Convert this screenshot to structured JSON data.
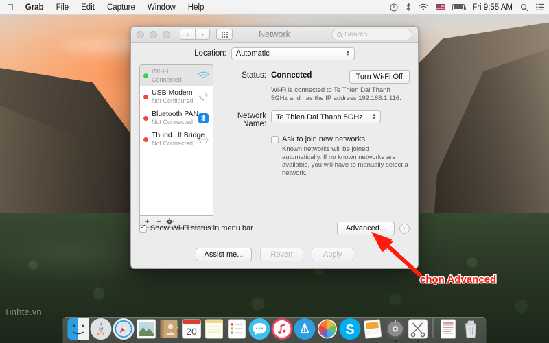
{
  "menubar": {
    "apple_icon": "apple-logo",
    "items": [
      {
        "label": "Grab",
        "bold": true
      },
      {
        "label": "File",
        "bold": false
      },
      {
        "label": "Edit",
        "bold": false
      },
      {
        "label": "Capture",
        "bold": false
      },
      {
        "label": "Window",
        "bold": false
      },
      {
        "label": "Help",
        "bold": false
      }
    ],
    "status_icons": [
      "power-icon",
      "bluetooth-icon",
      "wifi-icon",
      "us-flag-icon",
      "battery-icon"
    ],
    "clock": "Fri 9:55 AM",
    "search_icon": "spotlight-search-icon",
    "notification_icon": "notification-center-icon"
  },
  "window": {
    "title": "Network",
    "search_placeholder": "Search",
    "nav_back": "‹",
    "nav_forward": "›",
    "grid_icon": "show-all-grid-icon",
    "location_label": "Location:",
    "location_value": "Automatic"
  },
  "services": [
    {
      "name": "Wi-Fi",
      "state": "Connected",
      "dot": "green",
      "icon": "wifi-icon",
      "selected": true
    },
    {
      "name": "USB Modem",
      "state": "Not Configured",
      "dot": "red",
      "icon": "modem-phone-icon",
      "selected": false
    },
    {
      "name": "Bluetooth PAN",
      "state": "Not Connected",
      "dot": "red",
      "icon": "bluetooth-icon",
      "selected": false
    },
    {
      "name": "Thund...lt Bridge",
      "state": "Not Connected",
      "dot": "red",
      "icon": "thunderbolt-bridge-icon",
      "selected": false
    }
  ],
  "sidebar_footer": {
    "add_label": "+",
    "remove_label": "−",
    "gear_label": "gear-icon"
  },
  "pane": {
    "status_label": "Status:",
    "status_value": "Connected",
    "toggle_button": "Turn Wi-Fi Off",
    "status_hint": "Wi-Fi is connected to Te Thien Dai Thanh 5GHz and has the IP address 192.168.1.116.",
    "network_name_label": "Network Name:",
    "network_name_value": "Te Thien Dai Thanh 5GHz",
    "ask_join_label": "Ask to join new networks",
    "ask_join_checked": false,
    "ask_join_hint": "Known networks will be joined automatically. If no known networks are available, you will have to manually select a network."
  },
  "bottom": {
    "show_status_label": "Show Wi-Fi status in menu bar",
    "show_status_checked": true,
    "advanced_button": "Advanced...",
    "help_button": "?",
    "assist_button": "Assist me...",
    "revert_button": "Revert",
    "apply_button": "Apply"
  },
  "annotation": {
    "text": "chọn Advanced",
    "color": "#ff1c0f",
    "arrow_name": "red-arrow-pointing-to-advanced"
  },
  "desktop": {
    "watermark": "Tinhte.vn"
  },
  "dock": {
    "items": [
      {
        "name": "finder",
        "running": true
      },
      {
        "name": "launchpad",
        "running": false
      },
      {
        "name": "safari",
        "running": true
      },
      {
        "name": "photos-preview",
        "running": false
      },
      {
        "name": "contacts",
        "running": false
      },
      {
        "name": "calendar",
        "running": false
      },
      {
        "name": "notes",
        "running": false
      },
      {
        "name": "reminders",
        "running": false
      },
      {
        "name": "messages",
        "running": false
      },
      {
        "name": "itunes",
        "running": false
      },
      {
        "name": "app-store",
        "running": false
      },
      {
        "name": "photos",
        "running": false
      },
      {
        "name": "skype",
        "running": false
      },
      {
        "name": "keynote",
        "running": false
      },
      {
        "name": "system-preferences",
        "running": true
      },
      {
        "name": "grab",
        "running": true
      }
    ],
    "right_items": [
      {
        "name": "document",
        "running": false
      },
      {
        "name": "trash",
        "running": false
      }
    ]
  }
}
